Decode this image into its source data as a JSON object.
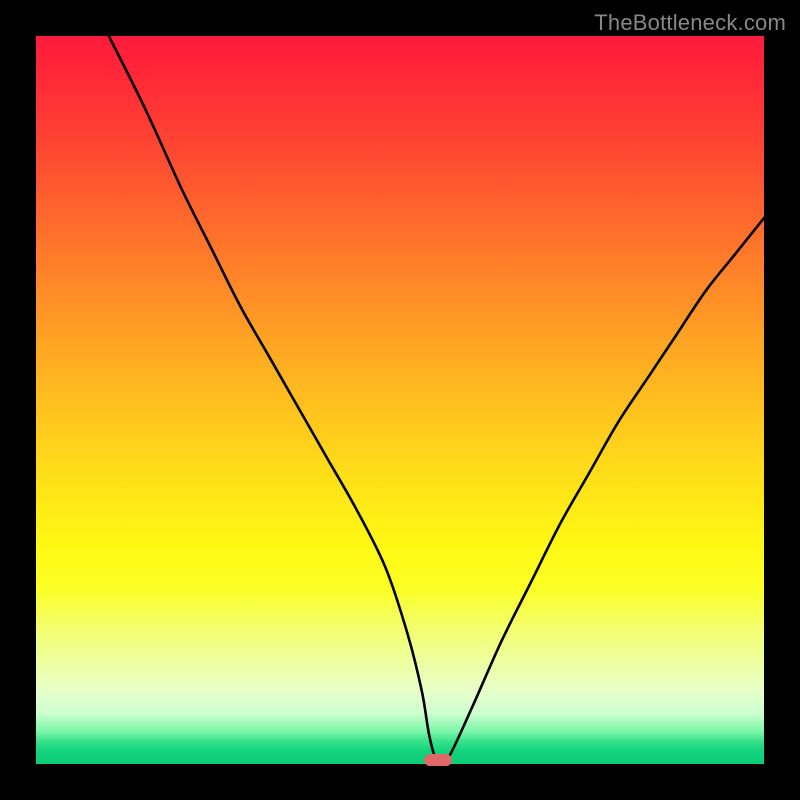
{
  "watermark": "TheBottleneck.com",
  "colors": {
    "background": "#000000",
    "watermark_text": "#888888",
    "curve_stroke": "#000000",
    "marker_fill": "#e06868"
  },
  "chart_data": {
    "type": "line",
    "title": "",
    "xlabel": "",
    "ylabel": "",
    "xlim": [
      0,
      100
    ],
    "ylim": [
      0,
      100
    ],
    "x": [
      10,
      15,
      20,
      24,
      28,
      32,
      36,
      40,
      44,
      48,
      51,
      53,
      54,
      55,
      56,
      57,
      60,
      64,
      68,
      72,
      76,
      80,
      84,
      88,
      92,
      96,
      100
    ],
    "values": [
      100,
      90,
      79,
      71,
      63,
      56,
      49,
      42,
      35,
      27,
      18,
      10,
      4,
      0.5,
      0.5,
      1.5,
      8,
      17,
      25,
      33,
      40,
      47,
      53,
      59,
      65,
      70,
      75
    ],
    "marker": {
      "x": 55.2,
      "y": 0.5
    },
    "grid": false,
    "annotations": []
  }
}
